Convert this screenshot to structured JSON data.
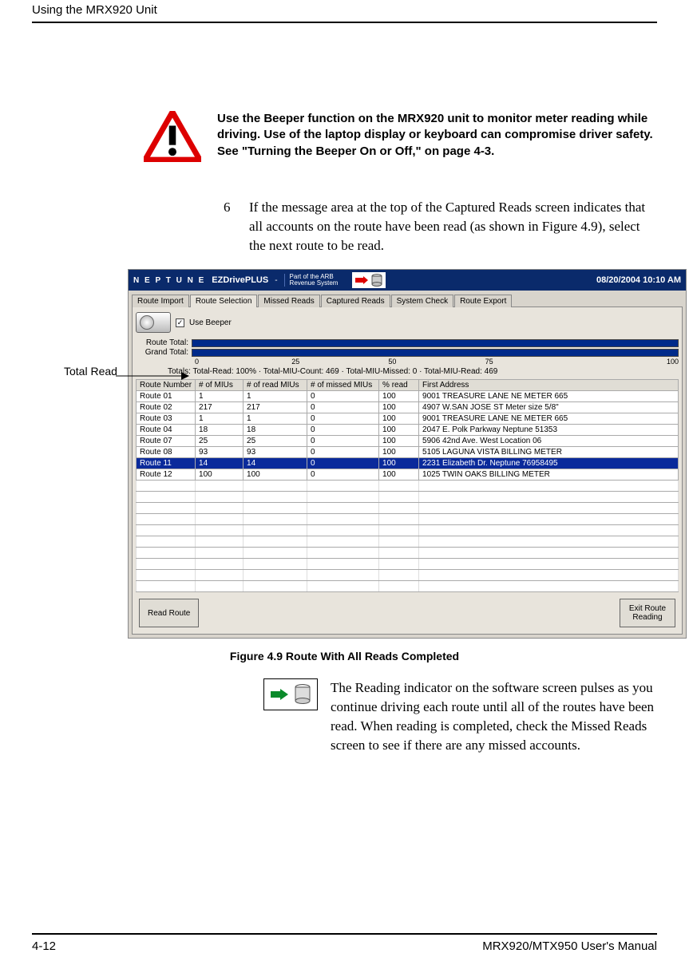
{
  "page": {
    "running_head": "Using the MRX920 Unit",
    "page_number": "4-12",
    "manual_title": "MRX920/MTX950 User's Manual"
  },
  "warning": {
    "text": "Use the Beeper function on the MRX920 unit to monitor meter reading while driving. Use of the laptop display or keyboard can compromise driver safety. See \"Turning the Beeper On or Off,\" on page 4-3."
  },
  "step": {
    "number": "6",
    "text": "If the message area at the top of the Captured Reads screen indicates that all accounts on the route have been read (as shown in Figure 4.9), select the next route to be read."
  },
  "callout": {
    "label": "Total Read"
  },
  "app": {
    "brand": "N E P T U N E",
    "product": "EZDrivePLUS",
    "subtitle1": "Part of the ARB",
    "subtitle2": "Revenue System",
    "datetime": "08/20/2004 10:10 AM",
    "tabs": [
      "Route Import",
      "Route Selection",
      "Missed Reads",
      "Captured Reads",
      "System Check",
      "Route Export"
    ],
    "active_tab_index": 1,
    "use_beeper_label": "Use Beeper",
    "use_beeper_checked": true,
    "progress": {
      "route_total_label": "Route Total:",
      "grand_total_label": "Grand Total:",
      "scale": [
        "0",
        "25",
        "50",
        "75",
        "100"
      ]
    },
    "totals_line": "Totals: Total-Read: 100%  ·  Total-MIU-Count: 469  ·  Total-MIU-Missed: 0  ·  Total-MIU-Read: 469",
    "columns": [
      "Route Number",
      "# of MIUs",
      "# of read MIUs",
      "# of missed MIUs",
      "% read",
      "First Address"
    ],
    "rows": [
      {
        "route": "Route 01",
        "mius": "1",
        "read": "1",
        "missed": "0",
        "pct": "100",
        "addr": "9001 TREASURE LANE NE   METER 665"
      },
      {
        "route": "Route 02",
        "mius": "217",
        "read": "217",
        "missed": "0",
        "pct": "100",
        "addr": "4907 W.SAN JOSE ST     Meter size  5/8\""
      },
      {
        "route": "Route 03",
        "mius": "1",
        "read": "1",
        "missed": "0",
        "pct": "100",
        "addr": "9001 TREASURE LANE NE   METER 665"
      },
      {
        "route": "Route 04",
        "mius": "18",
        "read": "18",
        "missed": "0",
        "pct": "100",
        "addr": "2047 E. Polk Parkway    Neptune 51353"
      },
      {
        "route": "Route 07",
        "mius": "25",
        "read": "25",
        "missed": "0",
        "pct": "100",
        "addr": "5906 42nd Ave. West     Location 06"
      },
      {
        "route": "Route 08",
        "mius": "93",
        "read": "93",
        "missed": "0",
        "pct": "100",
        "addr": "5105 LAGUNA VISTA       BILLING METER"
      },
      {
        "route": "Route 11",
        "mius": "14",
        "read": "14",
        "missed": "0",
        "pct": "100",
        "addr": "2231 Elizabeth Dr.       Neptune 76958495",
        "selected": true
      },
      {
        "route": "Route 12",
        "mius": "100",
        "read": "100",
        "missed": "0",
        "pct": "100",
        "addr": "1025 TWIN OAKS          BILLING METER"
      }
    ],
    "empty_rows": 10,
    "buttons": {
      "read_route": "Read Route",
      "exit_route_reading": "Exit Route\nReading"
    }
  },
  "figure_caption": "Figure 4.9   Route With All Reads Completed",
  "indicator_para": "The Reading indicator on the software screen pulses as you continue driving each route until all of the routes have been read. When reading is completed, check the Missed Reads screen to see if there are any missed accounts."
}
